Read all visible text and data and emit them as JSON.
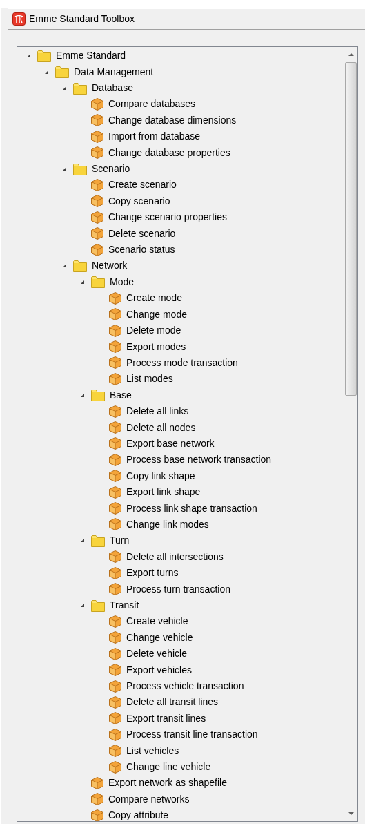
{
  "panel": {
    "title": "Emme Standard Toolbox"
  },
  "tree": [
    {
      "kind": "folder",
      "label": "Emme Standard",
      "expanded": true,
      "children": [
        {
          "kind": "folder",
          "label": "Data Management",
          "expanded": true,
          "children": [
            {
              "kind": "folder",
              "label": "Database",
              "expanded": true,
              "children": [
                {
                  "kind": "tool",
                  "label": "Compare databases"
                },
                {
                  "kind": "tool",
                  "label": "Change database dimensions"
                },
                {
                  "kind": "tool",
                  "label": "Import from database"
                },
                {
                  "kind": "tool",
                  "label": "Change database properties"
                }
              ]
            },
            {
              "kind": "folder",
              "label": "Scenario",
              "expanded": true,
              "children": [
                {
                  "kind": "tool",
                  "label": "Create scenario"
                },
                {
                  "kind": "tool",
                  "label": "Copy scenario"
                },
                {
                  "kind": "tool",
                  "label": "Change scenario properties"
                },
                {
                  "kind": "tool",
                  "label": "Delete scenario"
                },
                {
                  "kind": "tool",
                  "label": "Scenario status"
                }
              ]
            },
            {
              "kind": "folder",
              "label": "Network",
              "expanded": true,
              "children": [
                {
                  "kind": "folder",
                  "label": "Mode",
                  "expanded": true,
                  "children": [
                    {
                      "kind": "tool",
                      "label": "Create mode"
                    },
                    {
                      "kind": "tool",
                      "label": "Change mode"
                    },
                    {
                      "kind": "tool",
                      "label": "Delete mode"
                    },
                    {
                      "kind": "tool",
                      "label": "Export modes"
                    },
                    {
                      "kind": "tool",
                      "label": "Process mode transaction"
                    },
                    {
                      "kind": "tool",
                      "label": "List modes"
                    }
                  ]
                },
                {
                  "kind": "folder",
                  "label": "Base",
                  "expanded": true,
                  "children": [
                    {
                      "kind": "tool",
                      "label": "Delete all links"
                    },
                    {
                      "kind": "tool",
                      "label": "Delete all nodes"
                    },
                    {
                      "kind": "tool",
                      "label": "Export base network"
                    },
                    {
                      "kind": "tool",
                      "label": "Process base network transaction"
                    },
                    {
                      "kind": "tool",
                      "label": "Copy link shape"
                    },
                    {
                      "kind": "tool",
                      "label": "Export link shape"
                    },
                    {
                      "kind": "tool",
                      "label": "Process link shape transaction"
                    },
                    {
                      "kind": "tool",
                      "label": "Change link modes"
                    }
                  ]
                },
                {
                  "kind": "folder",
                  "label": "Turn",
                  "expanded": true,
                  "children": [
                    {
                      "kind": "tool",
                      "label": "Delete all intersections"
                    },
                    {
                      "kind": "tool",
                      "label": "Export turns"
                    },
                    {
                      "kind": "tool",
                      "label": "Process turn transaction"
                    }
                  ]
                },
                {
                  "kind": "folder",
                  "label": "Transit",
                  "expanded": true,
                  "children": [
                    {
                      "kind": "tool",
                      "label": "Create vehicle"
                    },
                    {
                      "kind": "tool",
                      "label": "Change vehicle"
                    },
                    {
                      "kind": "tool",
                      "label": "Delete vehicle"
                    },
                    {
                      "kind": "tool",
                      "label": "Export vehicles"
                    },
                    {
                      "kind": "tool",
                      "label": "Process vehicle transaction"
                    },
                    {
                      "kind": "tool",
                      "label": "Delete all transit lines"
                    },
                    {
                      "kind": "tool",
                      "label": "Export transit lines"
                    },
                    {
                      "kind": "tool",
                      "label": "Process transit line transaction"
                    },
                    {
                      "kind": "tool",
                      "label": "List vehicles"
                    },
                    {
                      "kind": "tool",
                      "label": "Change line vehicle"
                    }
                  ]
                },
                {
                  "kind": "tool",
                  "label": "Export network as shapefile"
                },
                {
                  "kind": "tool",
                  "label": "Compare networks"
                },
                {
                  "kind": "tool",
                  "label": "Copy attribute"
                }
              ]
            }
          ]
        }
      ]
    }
  ]
}
